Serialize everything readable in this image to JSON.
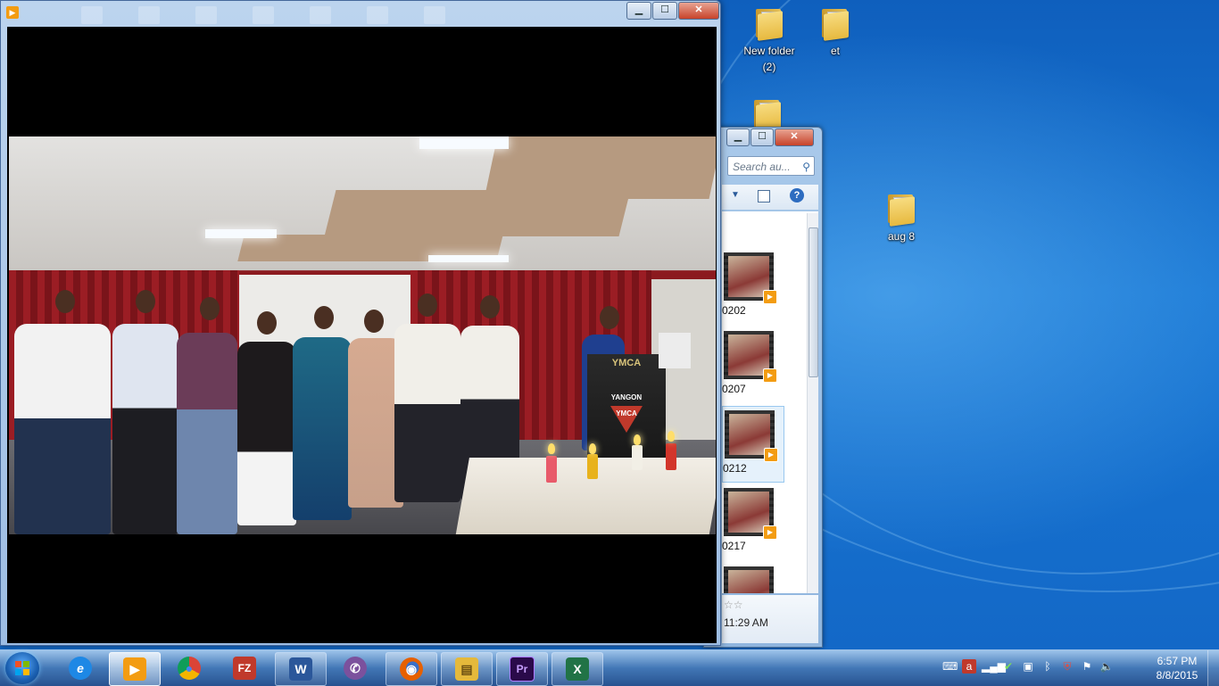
{
  "desktop": {
    "icons": [
      {
        "name": "desktop-icon-new-folder-2",
        "label_line1": "New folder",
        "label_line2": "(2)"
      },
      {
        "name": "desktop-icon-et",
        "label_line1": "et",
        "label_line2": ""
      },
      {
        "name": "desktop-icon-aug-8",
        "label_line1": "aug 8",
        "label_line2": ""
      }
    ]
  },
  "player": {
    "minimize": "▁",
    "maximize": "☐",
    "close": "✕",
    "frame_signs": {
      "podium": "YMCA",
      "logo_line1": "YANGON",
      "logo_line2": "YMCA"
    }
  },
  "explorer": {
    "minimize": "▁",
    "maximize": "☐",
    "close": "✕",
    "search_placeholder": "Search au...",
    "items": [
      {
        "label": "0202"
      },
      {
        "label": "0207"
      },
      {
        "label": "0212"
      },
      {
        "label": "0217"
      }
    ],
    "details_rating": "☆☆",
    "details_time": "11:29 AM"
  },
  "taskbar": {
    "apps": [
      {
        "name": "taskbar-ie",
        "glyph": "e",
        "color": "#1e88e5"
      },
      {
        "name": "taskbar-media-player",
        "glyph": "▶",
        "color": "#f39c12"
      },
      {
        "name": "taskbar-chrome",
        "glyph": "●",
        "color": "#2e9c44"
      },
      {
        "name": "taskbar-filezilla",
        "glyph": "FZ",
        "color": "#c0392b"
      },
      {
        "name": "taskbar-word",
        "glyph": "W",
        "color": "#2b579a"
      },
      {
        "name": "taskbar-viber",
        "glyph": "✆",
        "color": "#7b519d"
      },
      {
        "name": "taskbar-firefox",
        "glyph": "◉",
        "color": "#e66000"
      },
      {
        "name": "taskbar-explorer",
        "glyph": "▤",
        "color": "#e5b93b"
      },
      {
        "name": "taskbar-premiere",
        "glyph": "Pr",
        "color": "#2a0a4a"
      },
      {
        "name": "taskbar-excel",
        "glyph": "X",
        "color": "#217346"
      }
    ],
    "time": "6:57 PM",
    "date": "8/8/2015"
  }
}
